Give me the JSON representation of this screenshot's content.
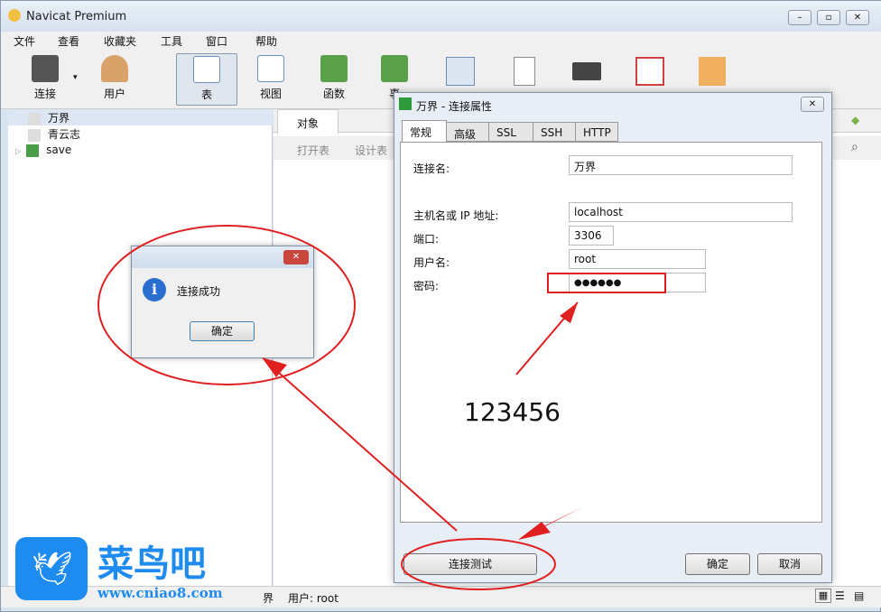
{
  "app": {
    "title": "Navicat Premium"
  },
  "menu": [
    "文件",
    "查看",
    "收藏夹",
    "工具",
    "窗口",
    "帮助"
  ],
  "toolbar": [
    {
      "label": "连接",
      "icon": "plug-icon"
    },
    {
      "label": "用户",
      "icon": "user-icon"
    },
    {
      "label": "表",
      "icon": "table-icon"
    },
    {
      "label": "视图",
      "icon": "view-icon"
    },
    {
      "label": "函数",
      "icon": "function-icon"
    },
    {
      "label": "事",
      "icon": "event-icon"
    }
  ],
  "tree": [
    "万界",
    "青云志",
    "save"
  ],
  "objects": {
    "tab": "对象",
    "open_table": "打开表",
    "design_table": "设计表"
  },
  "status": {
    "conn": "界",
    "user": "用户: root"
  },
  "dialog": {
    "title": "万界 - 连接属性",
    "tabs": [
      "常规",
      "高级",
      "SSL",
      "SSH",
      "HTTP"
    ],
    "fields": [
      {
        "label": "连接名:",
        "value": "万界"
      },
      {
        "label": "主机名或 IP 地址:",
        "value": "localhost"
      },
      {
        "label": "端口:",
        "value": "3306"
      },
      {
        "label": "用户名:",
        "value": "root"
      },
      {
        "label": "密码:",
        "value": "●●●●●●"
      }
    ],
    "test_button": "连接测试",
    "ok": "确定",
    "cancel": "取消"
  },
  "msgbox": {
    "text": "连接成功",
    "ok": "确定"
  },
  "annotation": {
    "password_hint": "123456",
    "color": "#e02020"
  },
  "watermark": {
    "name": "菜鸟吧",
    "url": "www.cniao8.com"
  }
}
